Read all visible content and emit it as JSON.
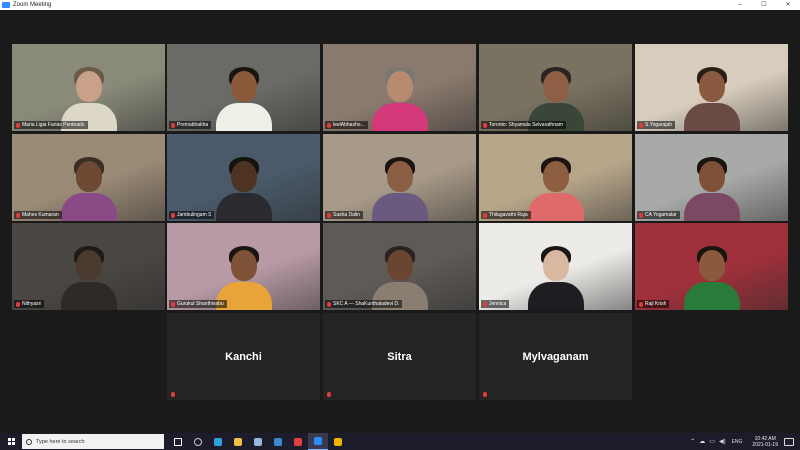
{
  "window": {
    "title": "Zoom Meeting",
    "controls": [
      "–",
      "☐",
      "✕"
    ]
  },
  "participants": [
    {
      "name": "Maria Ligia Farias Penteado",
      "active": false,
      "bg": "#8a8a7a",
      "skin": "#c9a088",
      "hair": "#6b5a48",
      "shirt": "#ddd7c8"
    },
    {
      "name": "Premabhakha",
      "active": true,
      "bg": "#6a6a66",
      "skin": "#8a5a3a",
      "hair": "#1a1410",
      "shirt": "#efefe8"
    },
    {
      "name": "leelAbhasho...",
      "active": false,
      "bg": "#8a7a6e",
      "skin": "#b88a70",
      "hair": "#7a7670",
      "shirt": "#d43a7a"
    },
    {
      "name": "Toronto: Shyamala Selvarathnam",
      "active": false,
      "bg": "#7a7260",
      "skin": "#8e5f44",
      "hair": "#2a2420",
      "shirt": "#3a4638"
    },
    {
      "name": "S.Yogarajah",
      "active": false,
      "bg": "#d8cdbd",
      "skin": "#8a5a40",
      "hair": "#2a2018",
      "shirt": "#6a4a44"
    },
    {
      "name": "Mahes Kumaran",
      "active": false,
      "bg": "#9a8a76",
      "skin": "#6e4a34",
      "hair": "#3a2e24",
      "shirt": "#8a4a86"
    },
    {
      "name": "Jambulingam S",
      "active": false,
      "bg": "#4a5a6a",
      "skin": "#4e3322",
      "hair": "#151210",
      "shirt": "#2a2a30"
    },
    {
      "name": "Sasha Dalin",
      "active": false,
      "bg": "#a89a88",
      "skin": "#8a5e42",
      "hair": "#1a1410",
      "shirt": "#6a5a80"
    },
    {
      "name": "Thilagavathi Raja",
      "active": false,
      "bg": "#b8a68a",
      "skin": "#8e5e40",
      "hair": "#1a1410",
      "shirt": "#e06a6a"
    },
    {
      "name": "CA Yogamalar",
      "active": false,
      "bg": "#a8aaa8",
      "skin": "#7e5238",
      "hair": "#1a1410",
      "shirt": "#7a4a62"
    },
    {
      "name": "Nithyasri",
      "active": false,
      "bg": "#4a4642",
      "skin": "#4a3a30",
      "hair": "#1e1a16",
      "shirt": "#2e2a28"
    },
    {
      "name": "Gurukul Shanthivabu",
      "active": false,
      "bg": "#b89aa6",
      "skin": "#7e5236",
      "hair": "#1a1410",
      "shirt": "#e8a438"
    },
    {
      "name": "SKC A — ShaKunthaladevi D.",
      "active": false,
      "bg": "#5e5a56",
      "skin": "#6a4632",
      "hair": "#2a2420",
      "shirt": "#8a7e72"
    },
    {
      "name": "Jennica",
      "active": false,
      "bg": "#ecebe8",
      "skin": "#d8b8a0",
      "hair": "#1a1614",
      "shirt": "#1e1e22"
    },
    {
      "name": "Raji Krish",
      "active": false,
      "bg": "#a0303a",
      "skin": "#8a5a3e",
      "hair": "#1a1410",
      "shirt": "#2a7a3a"
    }
  ],
  "no_video": [
    {
      "name": "Kanchi"
    },
    {
      "name": "Sitra"
    },
    {
      "name": "Mylvaganam"
    }
  ],
  "taskbar": {
    "search_placeholder": "Type here to search",
    "apps": [
      {
        "icon": "task-view-icon",
        "color": "#ffffff"
      },
      {
        "icon": "cortana-icon",
        "color": "#cccccc"
      },
      {
        "icon": "edge-icon",
        "color": "#2fa0e0"
      },
      {
        "icon": "file-explorer-icon",
        "color": "#f0c040"
      },
      {
        "icon": "store-icon",
        "color": "#9ab8d8"
      },
      {
        "icon": "mail-icon",
        "color": "#3a8ad8"
      },
      {
        "icon": "chrome-alt-icon",
        "color": "#e04040"
      },
      {
        "icon": "zoom-icon",
        "color": "#2d8cff"
      },
      {
        "icon": "chrome-icon",
        "color": "#f4b400"
      }
    ],
    "tray_lang": "ENG",
    "time": "10:42 AM",
    "date": "2021-01-19"
  }
}
